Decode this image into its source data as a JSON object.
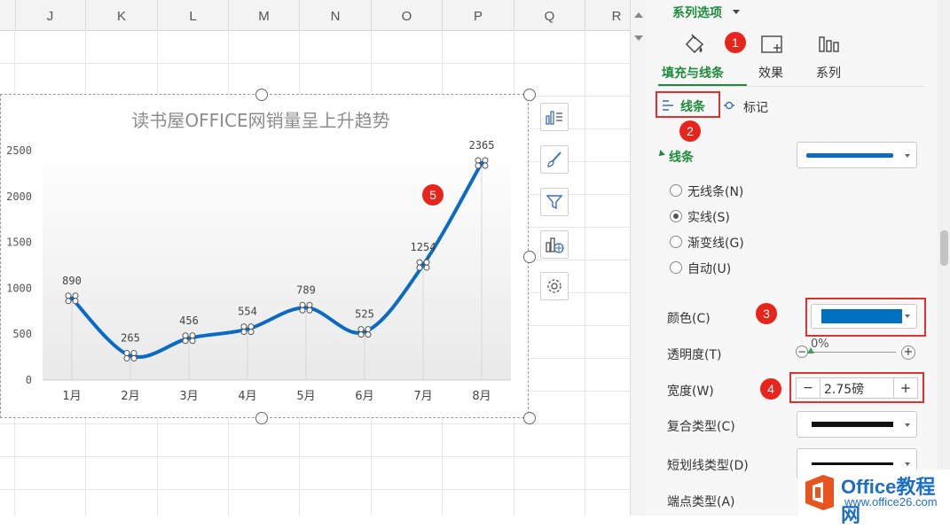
{
  "sheet": {
    "columns": [
      "J",
      "K",
      "L",
      "M",
      "N",
      "O",
      "P",
      "Q",
      "R"
    ]
  },
  "chart_data": {
    "type": "line",
    "title": "读书屋OFFICE网销量呈上升趋势",
    "categories": [
      "1月",
      "2月",
      "3月",
      "4月",
      "5月",
      "6月",
      "7月",
      "8月"
    ],
    "series": [
      {
        "values": [
          890,
          265,
          456,
          554,
          789,
          525,
          1254,
          2365
        ]
      }
    ],
    "data_labels": [
      "890",
      "265",
      "456",
      "554",
      "789",
      "525",
      "1254",
      "2365"
    ],
    "y_ticks": [
      "0",
      "500",
      "1000",
      "1500",
      "2000",
      "2500"
    ],
    "ylim": [
      0,
      2500
    ],
    "smooth": true,
    "line_color": "#0a6bc4",
    "markers": true
  },
  "chart_tools": [
    "chart-elements-icon",
    "chart-styles-icon",
    "chart-filter-icon",
    "chart-type-icon",
    "chart-settings-icon"
  ],
  "panel": {
    "header": "系列选项",
    "tabs": [
      {
        "label": "填充与线条",
        "active": true
      },
      {
        "label": "效果",
        "active": false
      },
      {
        "label": "系列",
        "active": false
      }
    ],
    "subtabs": [
      {
        "label": "线条",
        "active": true
      },
      {
        "label": "标记",
        "active": false
      }
    ],
    "section_title": "线条",
    "line_options": [
      {
        "label": "无线条(N)",
        "selected": false
      },
      {
        "label": "实线(S)",
        "selected": true
      },
      {
        "label": "渐变线(G)",
        "selected": false
      },
      {
        "label": "自动(U)",
        "selected": false
      }
    ],
    "color_label": "颜色(C)",
    "color_value": "#0070c0",
    "transparency_label": "透明度(T)",
    "transparency_value": "0%",
    "width_label": "宽度(W)",
    "width_value": "2.75磅",
    "minus": "−",
    "plus": "+",
    "compound_label": "复合类型(C)",
    "dash_label": "短划线类型(D)",
    "cap_label": "端点类型(A)"
  },
  "badges": [
    "1",
    "2",
    "3",
    "4",
    "5"
  ],
  "watermark": {
    "text": "Office教程网",
    "url": "www.office26.com"
  },
  "colors": {
    "accent_green": "#1f8a3c",
    "red": "#e03131",
    "line_blue": "#0a6bc4"
  }
}
